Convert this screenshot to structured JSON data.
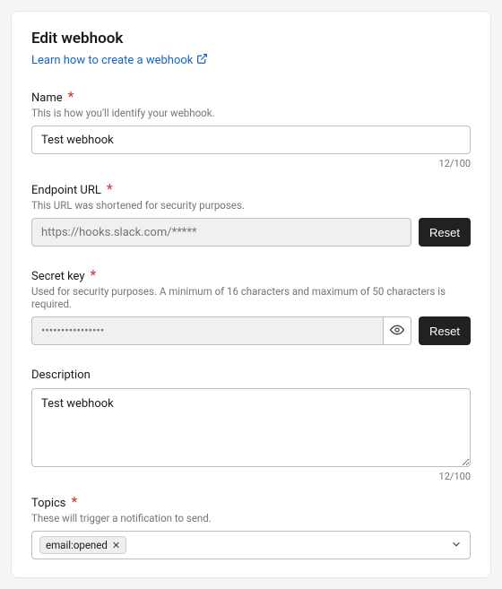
{
  "header": {
    "title": "Edit webhook",
    "learn_link": "Learn how to create a webhook"
  },
  "name": {
    "label": "Name",
    "help": "This is how you'll identify your webhook.",
    "value": "Test webhook",
    "counter": "12/100"
  },
  "endpoint": {
    "label": "Endpoint URL",
    "help": "This URL was shortened for security purposes.",
    "value": "https://hooks.slack.com/*****",
    "reset": "Reset"
  },
  "secret": {
    "label": "Secret key",
    "help": "Used for security purposes. A minimum of 16 characters and maximum of 50 characters is required.",
    "value": "••••••••••••••••",
    "reset": "Reset"
  },
  "description": {
    "label": "Description",
    "value": "Test webhook",
    "counter": "12/100"
  },
  "topics": {
    "label": "Topics",
    "help": "These will trigger a notification to send.",
    "selected": "email:opened"
  }
}
